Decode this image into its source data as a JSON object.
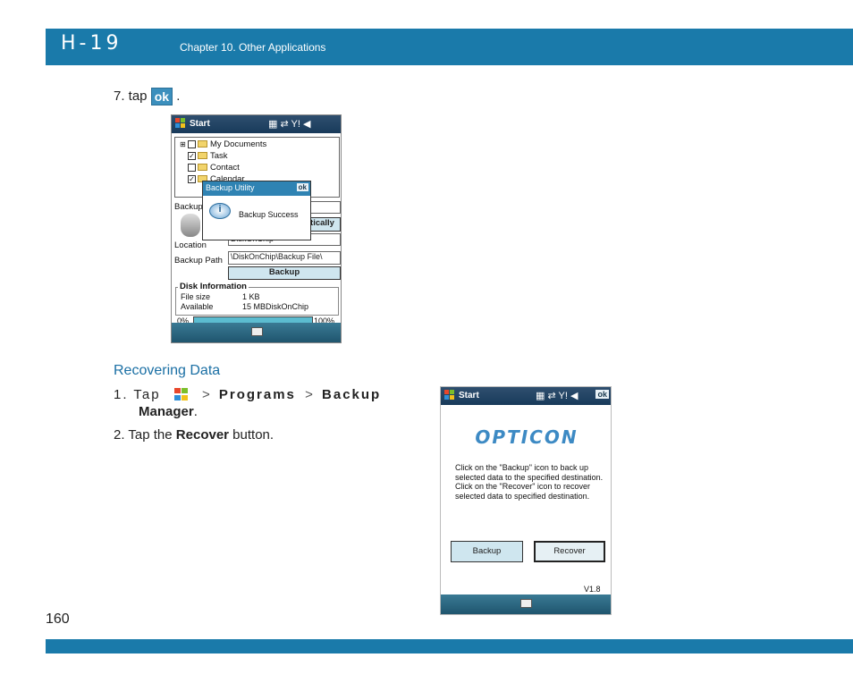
{
  "header": {
    "logo": "H-19",
    "chapter": "Chapter 10. Other Applications"
  },
  "page_number": "160",
  "step7": {
    "prefix": "7. tap",
    "ok": "ok",
    "suffix": "."
  },
  "screen1": {
    "start": "Start",
    "tree": [
      "My Documents",
      "Task",
      "Contact",
      "Calendar"
    ],
    "backup_label": "Backup",
    "dialog_title": "Backup Utility",
    "dialog_ok": "ok",
    "dialog_msg": "Backup Success",
    "auto_btn": "tically",
    "location_label": "Location",
    "location_value": "DiskOnChip",
    "path_label": "Backup Path",
    "path_value": "\\DiskOnChip\\Backup File\\",
    "backup_btn": "Backup",
    "disk_title": "Disk Information",
    "file_size_label": "File size",
    "file_size_value": "1 KB",
    "available_label": "Available",
    "available_value": "15 MB",
    "available_loc": "DiskOnChip",
    "progress_min": "0%",
    "progress_max": "100%"
  },
  "recover": {
    "heading": "Recovering Data",
    "step1_a": "1. Tap",
    "step1_sep1": ">",
    "step1_programs": "Programs",
    "step1_sep2": ">",
    "step1_backup": "Backup",
    "step1_manager": "Manager",
    "step1_end": ".",
    "step2_a": "2. Tap the",
    "step2_b": "Recover",
    "step2_c": "button."
  },
  "screen2": {
    "start": "Start",
    "ok": "ok",
    "brand": "OPTICON",
    "desc": "Click on the \"Backup\" icon to back up selected data to the specified destination. Click on the \"Recover\" icon to recover selected data to specified destination.",
    "backup_btn": "Backup",
    "recover_btn": "Recover",
    "version": "V1.8"
  },
  "colors": {
    "band": "#1a7aaa",
    "heading": "#1a6fa4"
  }
}
